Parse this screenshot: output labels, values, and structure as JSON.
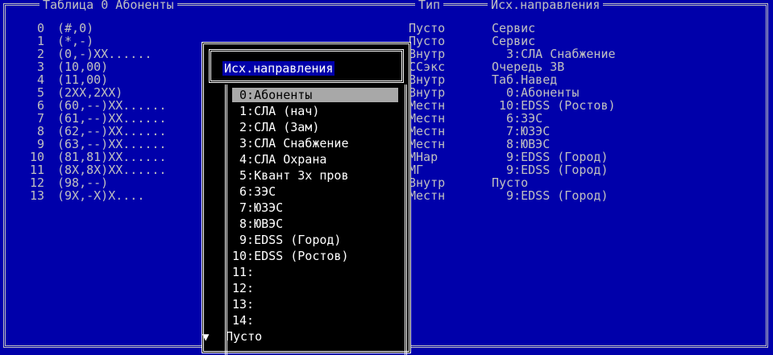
{
  "headers": {
    "table": "Таблица 0 Абоненты",
    "type": "Тип",
    "dir": "Исх.направления"
  },
  "rows": [
    {
      "num": "0",
      "code": "(#,0)",
      "type": "Пусто",
      "dir": "Сервис"
    },
    {
      "num": "1",
      "code": "(*,-)",
      "type": "Пусто",
      "dir": "Сервис"
    },
    {
      "num": "2",
      "code": "(0,-)XX......",
      "type": "Внутр",
      "dir": "  3:СЛА Снабжение"
    },
    {
      "num": "3",
      "code": "(10,00)",
      "type": "ССэкс",
      "dir": "Очередь ЗВ"
    },
    {
      "num": "4",
      "code": "(11,00)",
      "type": "Внутр",
      "dir": "Таб.Навед"
    },
    {
      "num": "5",
      "code": "(2XX,2XX)",
      "type": "Внутр",
      "dir": "  0:Абоненты"
    },
    {
      "num": "6",
      "code": "(60,--)XX......",
      "type": "Местн",
      "dir": " 10:EDSS (Ростов)"
    },
    {
      "num": "7",
      "code": "(61,--)XX......",
      "type": "Местн",
      "dir": "  6:ЗЭС"
    },
    {
      "num": "8",
      "code": "(62,--)XX......",
      "type": "Местн",
      "dir": "  7:ЮЗЭС"
    },
    {
      "num": "9",
      "code": "(63,--)XX......",
      "type": "Местн",
      "dir": "  8:ЮВЭС"
    },
    {
      "num": "10",
      "code": "(81,81)XX......",
      "type": "МНар",
      "dir": "  9:EDSS (Город)"
    },
    {
      "num": "11",
      "code": "(8X,8X)XX......",
      "type": "МГ",
      "dir": "  9:EDSS (Город)"
    },
    {
      "num": "12",
      "code": "(98,--)",
      "type": "Внутр",
      "dir": "Пусто"
    },
    {
      "num": "13",
      "code": "(9X,-X)X....",
      "type": "Местн",
      "dir": "  9:EDSS (Город)"
    }
  ],
  "popup": {
    "title": "Исх.направления",
    "items": [
      " 0:Абоненты",
      " 1:СЛА (нач)",
      " 2:СЛА (Зам)",
      " 3:СЛА Снабжение",
      " 4:СЛА Охрана",
      " 5:Квант 3х пров",
      " 6:ЗЭС",
      " 7:ЮЗЭС",
      " 8:ЮВЭС",
      " 9:EDSS (Город)",
      "10:EDSS (Ростов)",
      "11:",
      "12:",
      "13:",
      "14:",
      "Пусто"
    ],
    "selected_index": 0,
    "scroll_arrow": "▼"
  },
  "colors": {
    "background": "#0000aa",
    "text": "#c0c0c0",
    "popup_bg": "#000000",
    "selection": "#a8a8a8"
  }
}
